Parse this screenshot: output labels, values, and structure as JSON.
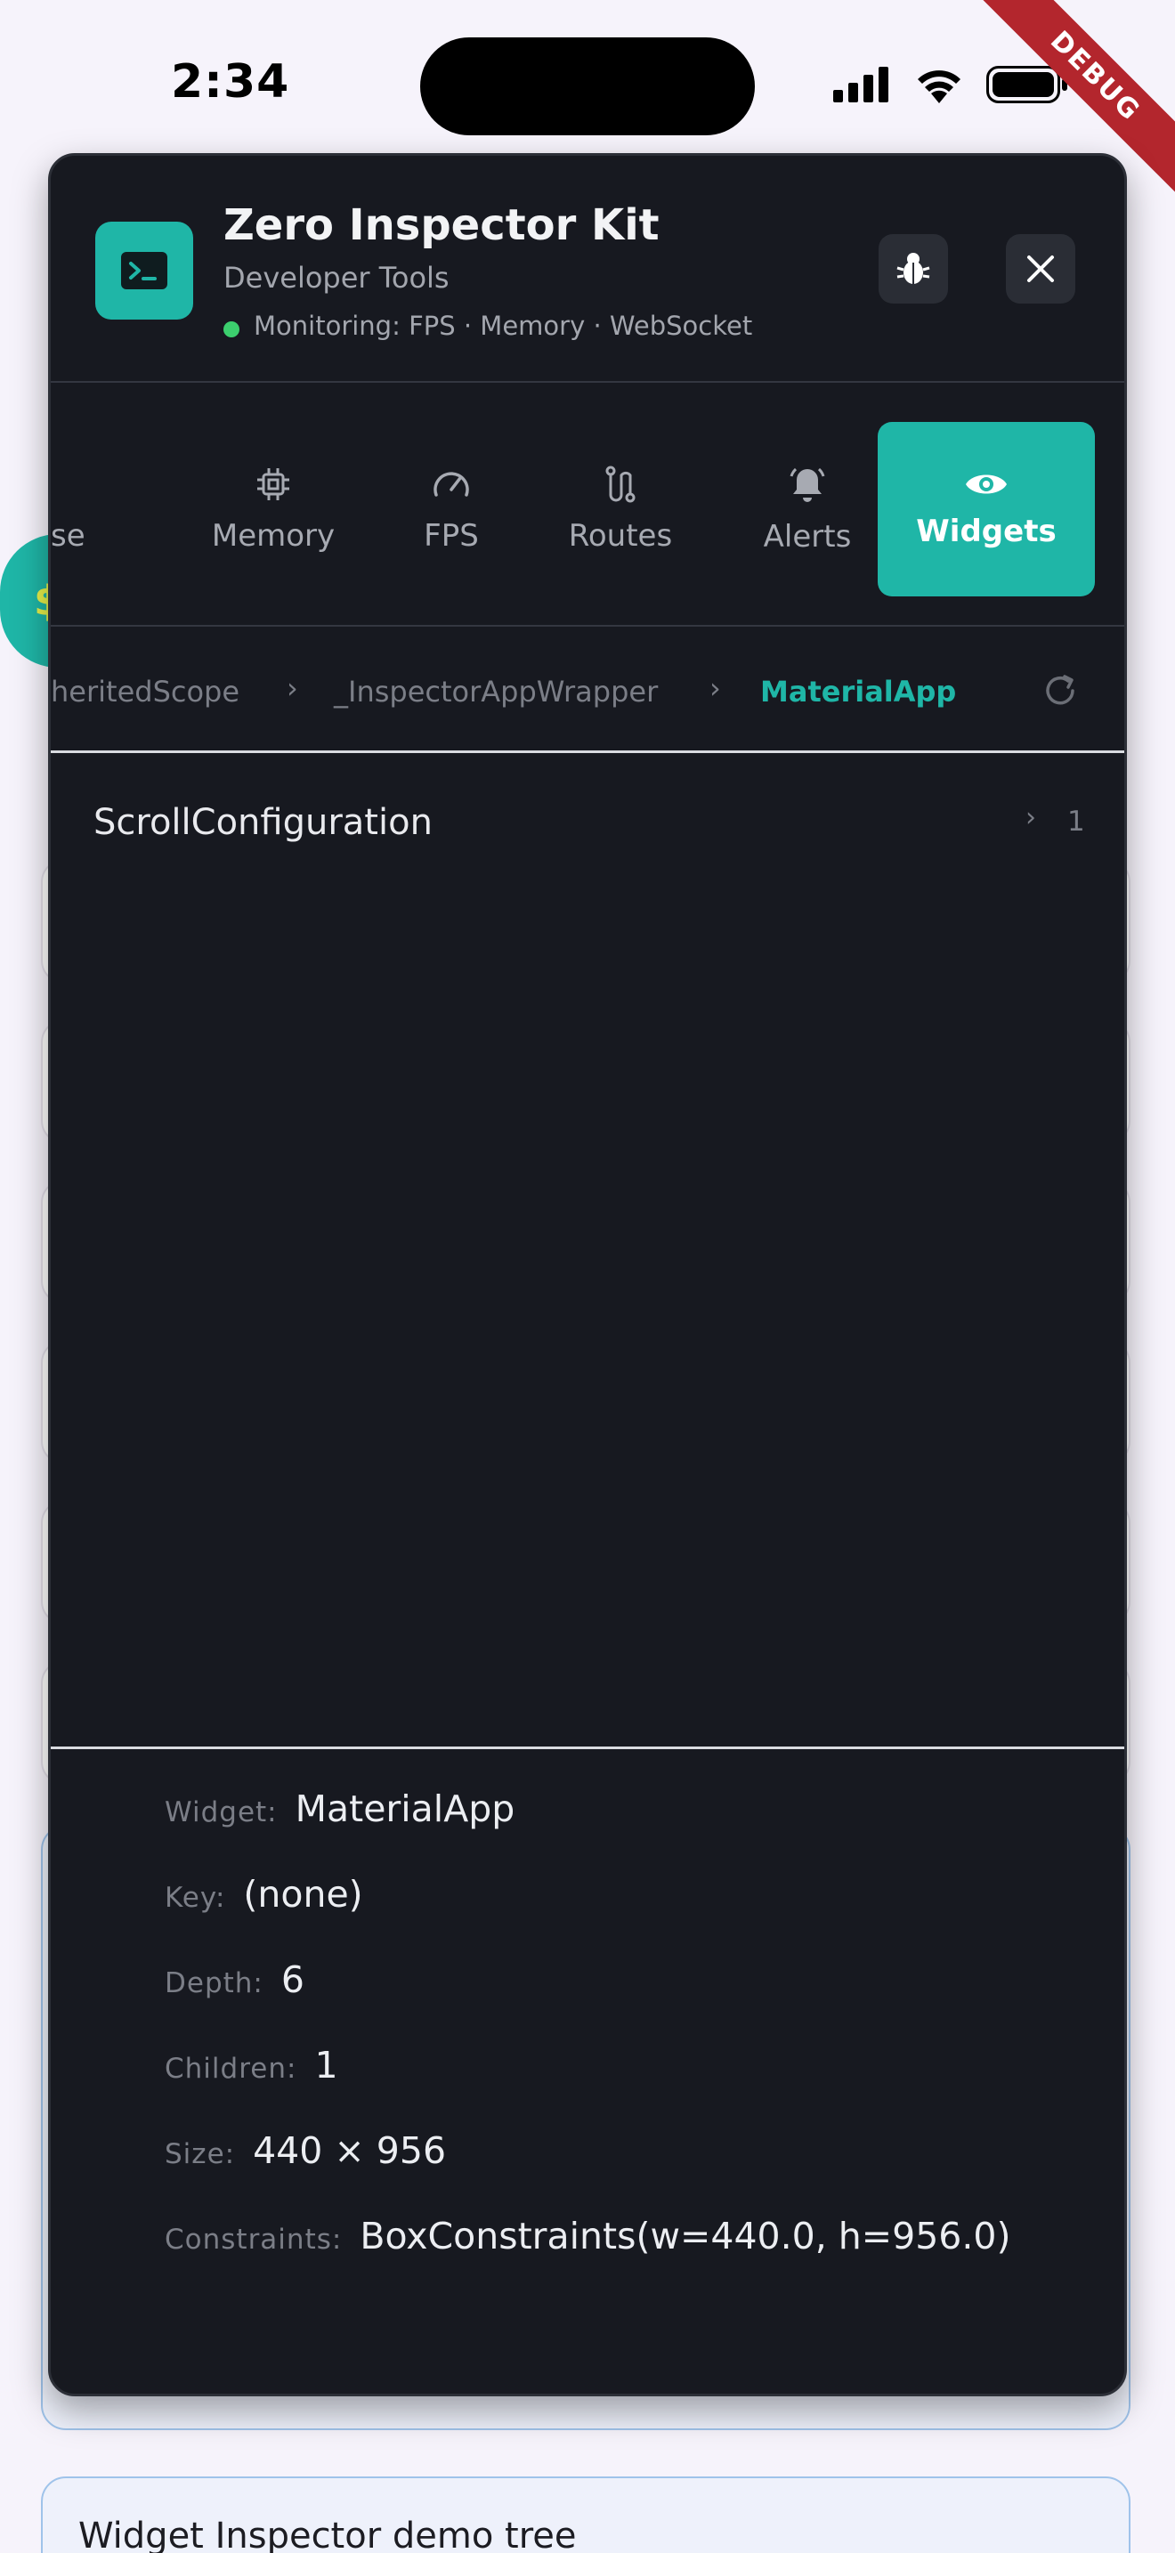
{
  "status_bar": {
    "time": "2:34",
    "debug_banner": "DEBUG",
    "icons": [
      "signal-icon",
      "wifi-icon",
      "battery-icon"
    ]
  },
  "background": {
    "fab_mark": "$",
    "bottom_card_title": "Widget Inspector demo tree"
  },
  "inspector": {
    "title": "Zero Inspector Kit",
    "subtitle": "Developer Tools",
    "monitoring": "Monitoring: FPS · Memory · WebSocket",
    "accent_color": "#1fb6a7",
    "tabs": [
      {
        "label": "se",
        "icon": "partial-tab-icon"
      },
      {
        "label": "Memory",
        "icon": "chip-icon"
      },
      {
        "label": "FPS",
        "icon": "speedometer-icon"
      },
      {
        "label": "Routes",
        "icon": "route-icon"
      },
      {
        "label": "Alerts",
        "icon": "bell-icon"
      },
      {
        "label": "Widgets",
        "icon": "eye-icon",
        "active": true
      }
    ],
    "breadcrumb": [
      "heritedScope",
      "_InspectorAppWrapper",
      "MaterialApp"
    ],
    "tree": [
      {
        "name": "ScrollConfiguration",
        "count": "1"
      }
    ],
    "details": [
      {
        "key": "Widget:",
        "value": "MaterialApp"
      },
      {
        "key": "Key:",
        "value": "(none)"
      },
      {
        "key": "Depth:",
        "value": "6"
      },
      {
        "key": "Children:",
        "value": "1"
      },
      {
        "key": "Size:",
        "value": "440 × 956"
      },
      {
        "key": "Constraints:",
        "value": "BoxConstraints(w=440.0, h=956.0)"
      }
    ]
  }
}
